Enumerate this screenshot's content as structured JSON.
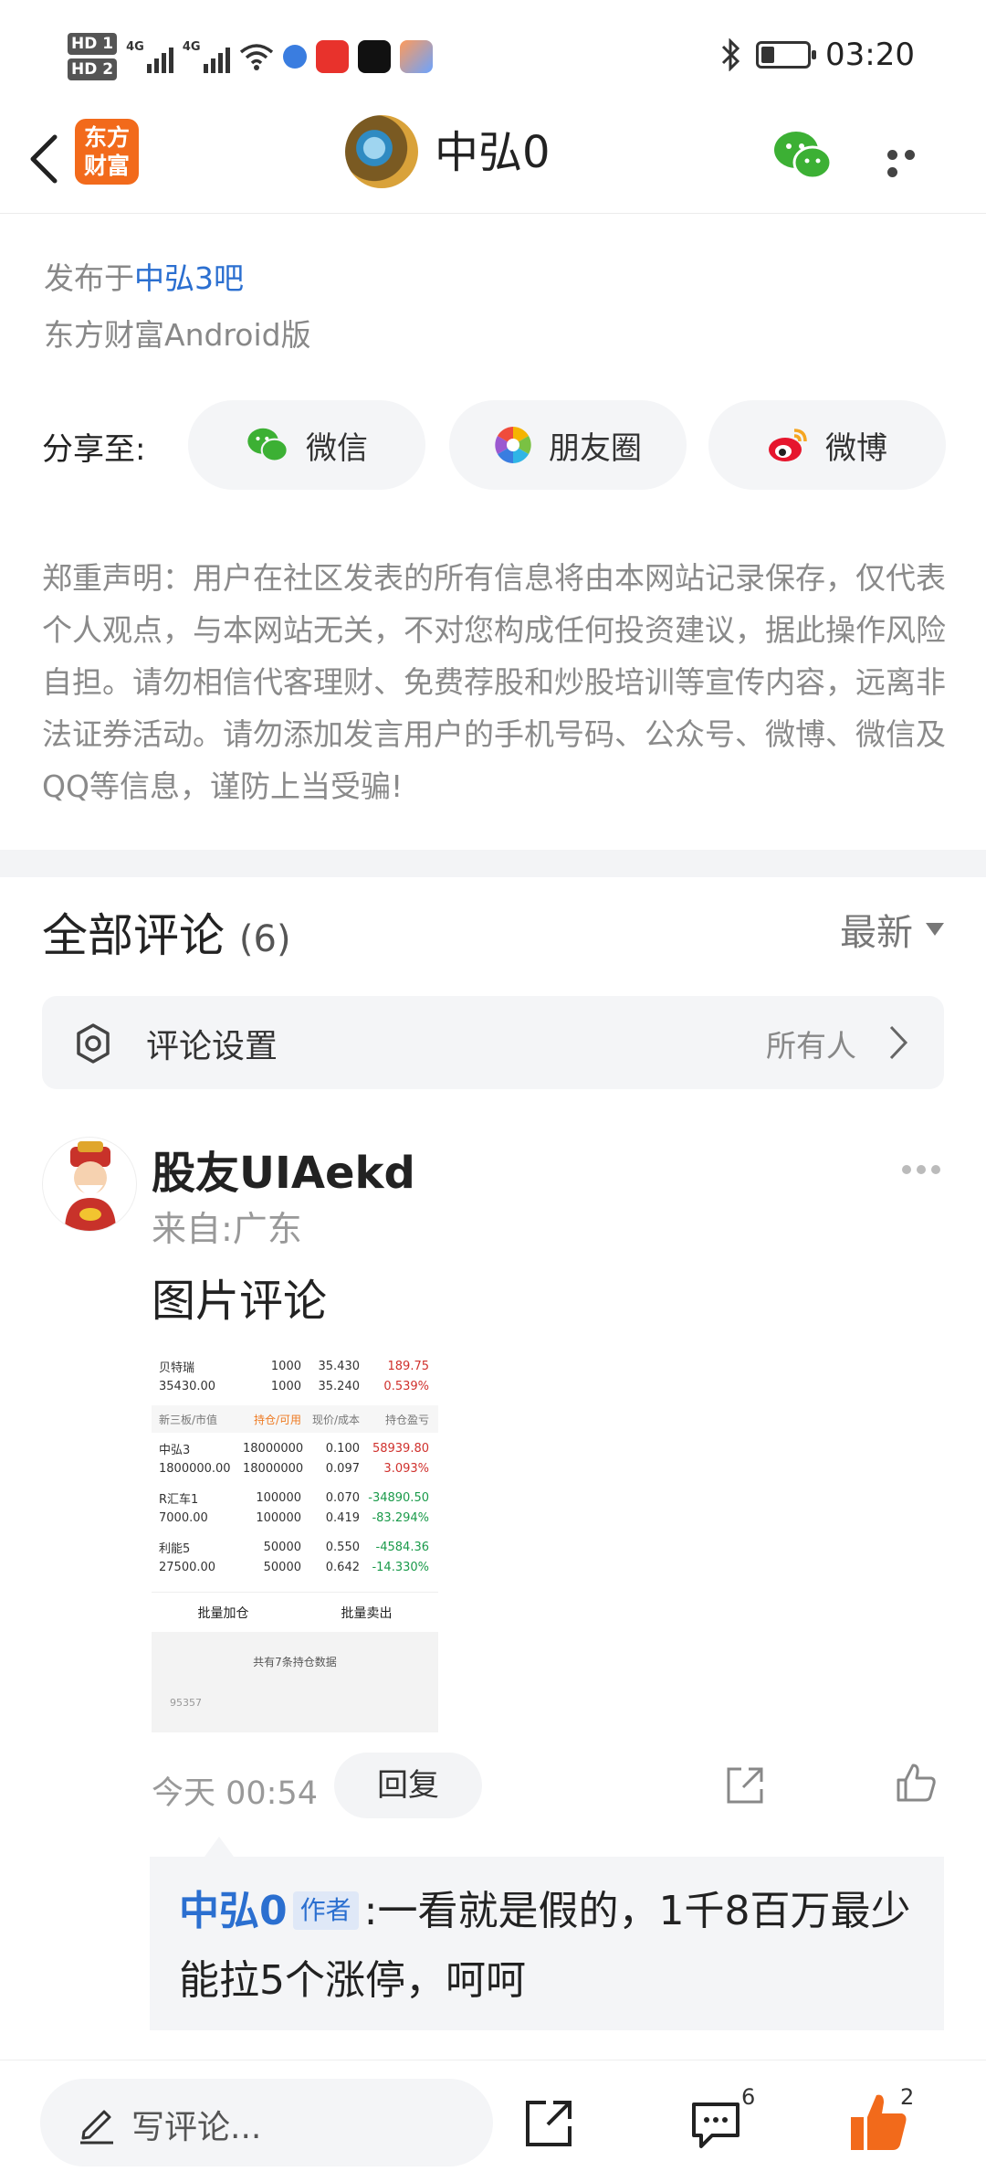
{
  "status_bar": {
    "hd1": "HD 1",
    "hd2": "HD 2",
    "sig1": "4G",
    "sig2": "4G",
    "time": "03:20"
  },
  "header": {
    "logo_line1": "东方",
    "logo_line2": "财富",
    "title": "中弘0"
  },
  "post": {
    "published_prefix": "发布于",
    "bar_name": "中弘3吧",
    "client": "东方财富Android版"
  },
  "share": {
    "label": "分享至:",
    "options": [
      "微信",
      "朋友圈",
      "微博"
    ]
  },
  "notice": "郑重声明：用户在社区发表的所有信息将由本网站记录保存，仅代表个人观点，与本网站无关，不对您构成任何投资建议，据此操作风险自担。请勿相信代客理财、免费荐股和炒股培训等宣传内容，远离非法证券活动。请勿添加发言用户的手机号码、公众号、微博、微信及QQ等信息，谨防上当受骗!",
  "comments_section": {
    "title": "全部评论",
    "count": "(6)",
    "sort": "最新",
    "settings_label": "评论设置",
    "settings_value": "所有人"
  },
  "comment": {
    "username": "股友UIAekd",
    "from": "来自:广东",
    "text": "图片评论",
    "time": "今天 00:54",
    "reply_label": "回复",
    "image": {
      "rows": [
        [
          "贝特瑞",
          "1000",
          "35.430",
          "189.75"
        ],
        [
          "35430.00",
          "1000",
          "35.240",
          "0.539%"
        ]
      ],
      "header": [
        "新三板/市值",
        "持仓/可用",
        "现价/成本",
        "持仓盈亏"
      ],
      "holdings": [
        {
          "r1": [
            "中弘3",
            "18000000",
            "0.100",
            "58939.80"
          ],
          "r2": [
            "1800000.00",
            "18000000",
            "0.097",
            "3.093%"
          ],
          "tone": "red"
        },
        {
          "r1": [
            "R汇车1",
            "100000",
            "0.070",
            "-34890.50"
          ],
          "r2": [
            "7000.00",
            "100000",
            "0.419",
            "-83.294%"
          ],
          "tone": "green"
        },
        {
          "r1": [
            "利能5",
            "50000",
            "0.550",
            "-4584.36"
          ],
          "r2": [
            "27500.00",
            "50000",
            "0.642",
            "-14.330%"
          ],
          "tone": "green"
        }
      ],
      "btn_add": "批量加仓",
      "btn_sell": "批量卖出",
      "footer": "共有7条持仓数据",
      "bottom_num": "95357"
    }
  },
  "reply": {
    "user": "中弘0",
    "tag": "作者",
    "text": ":一看就是假的，1千8百万最少能拉5个涨停，呵呵"
  },
  "bottom_bar": {
    "placeholder": "写评论...",
    "comment_count": "6",
    "like_count": "2"
  },
  "colors": {
    "brand_orange": "#f26a1b",
    "link_blue": "#2b6fd0",
    "wechat_green": "#3cb034",
    "like_orange": "#f26a1b"
  }
}
